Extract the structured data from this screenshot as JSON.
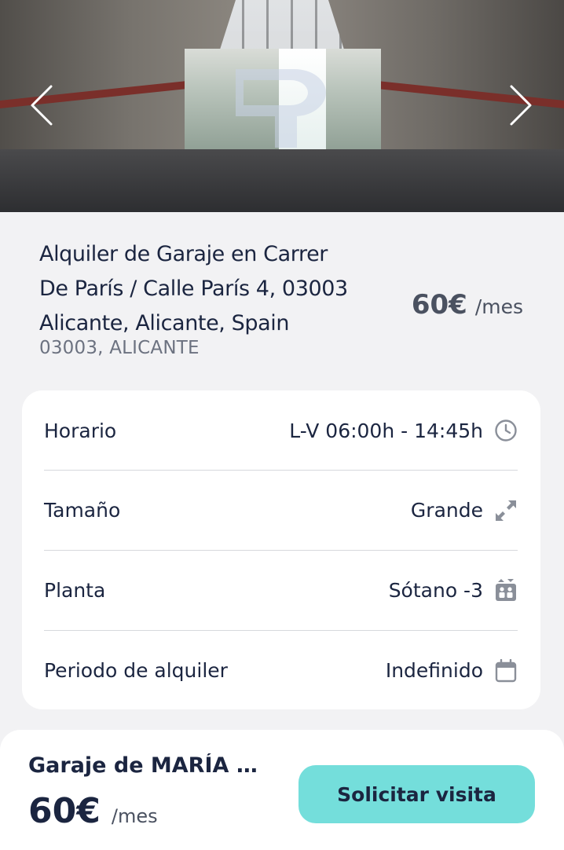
{
  "hero": {
    "prev_label": "previous photo",
    "next_label": "next photo"
  },
  "listing": {
    "title": "Alquiler de Garaje en Carrer De París / Calle París 4, 03003 Alicante, Alicante, Spain",
    "location": "03003, ALICANTE",
    "price": "60€",
    "price_unit": "/mes"
  },
  "details": [
    {
      "label": "Horario",
      "value": "L-V 06:00h - 14:45h",
      "icon": "clock-icon"
    },
    {
      "label": "Tamaño",
      "value": "Grande",
      "icon": "expand-arrows-icon"
    },
    {
      "label": "Planta",
      "value": "Sótano -3",
      "icon": "elevator-icon"
    },
    {
      "label": "Periodo de alquiler",
      "value": "Indefinido",
      "icon": "calendar-icon"
    }
  ],
  "bottom_bar": {
    "owner": "Garaje de MARÍA R...",
    "price": "60€",
    "price_unit": "/mes",
    "cta_label": "Solicitar visita"
  },
  "colors": {
    "accent": "#74dedb",
    "text": "#1b2540",
    "icon": "#8a8f99",
    "background": "#f2f2f4"
  }
}
